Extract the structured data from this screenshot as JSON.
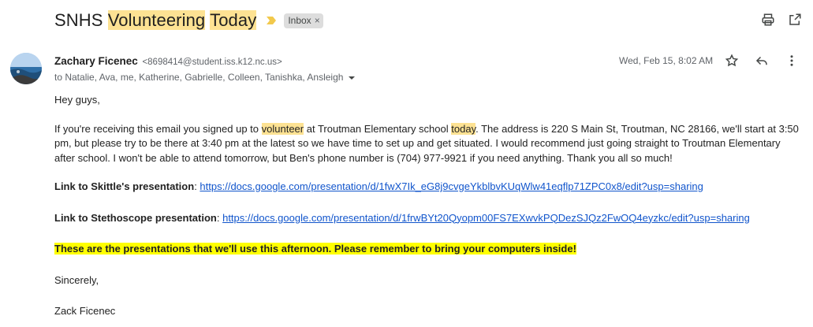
{
  "subject": {
    "part1": "SNHS ",
    "part2": "Volunteering",
    "part3": " ",
    "part4": "Today",
    "label": "Inbox",
    "label_close": "×"
  },
  "sender": {
    "name": "Zachary Ficenec",
    "email": "<8698414@student.iss.k12.nc.us>",
    "recipients": "to Natalie, Ava, me, Katherine, Gabrielle, Colleen, Tanishka, Ansleigh",
    "date": "Wed, Feb 15, 8:02 AM"
  },
  "body": {
    "greeting": "Hey guys,",
    "p1_a": "If you're receiving this email you signed up to ",
    "p1_hl1": "volunteer",
    "p1_b": " at Troutman Elementary school ",
    "p1_hl2": "today",
    "p1_c": ". The address is 220 S Main St, Troutman, NC 28166, we'll start at 3:50 pm, but please try to be there at 3:40 pm at the latest so we have time to set up and get situated. I would recommend just going straight to Troutman Elementary after school. I won't be able to attend tomorrow, but Ben's phone number is (704) 977-9921 if you need anything. Thank you all so much!",
    "link1_label": "Link to Skittle's presentation",
    "link1_sep": ": ",
    "link1_url": "https://docs.google.com/presentation/d/1fwX7Ik_eG8j9cvgeYkblbvKUqWlw41eqflp71ZPC0x8/edit?usp=sharing",
    "link2_label": "Link to Stethoscope presentation",
    "link2_sep": ": ",
    "link2_url": "https://docs.google.com/presentation/d/1frwBYt20Qyopm00FS7EXwvkPQDezSJQz2FwOQ4eyzkc/edit?usp=sharing",
    "highlight_note": "These are the presentations that we'll use this afternoon. Please remember to bring your computers inside!",
    "closing": "Sincerely,",
    "signature": "Zack Ficenec"
  },
  "icons": {
    "print": "print-icon",
    "open_new": "open-in-new-window-icon",
    "star": "star-icon",
    "reply": "reply-icon",
    "more": "more-vert-icon",
    "importance": "importance-marker-icon",
    "caret": "chevron-down-icon"
  },
  "colors": {
    "search_highlight": "#fde293",
    "note_highlight": "#ffff00",
    "link": "#1155cc",
    "importance": "#f2c94c"
  }
}
